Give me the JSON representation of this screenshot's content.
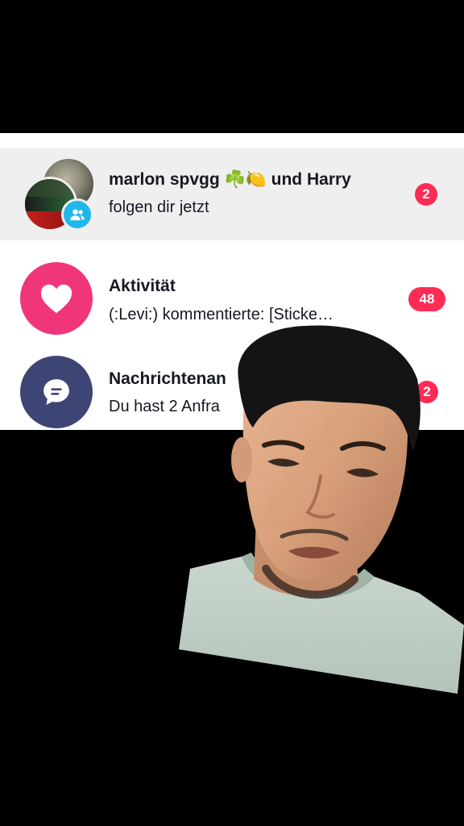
{
  "notifications": [
    {
      "title": "marlon spvgg ☘️🍋 und Harry",
      "subtitle": "folgen dir jetzt",
      "badge": "2",
      "icon": "group-followers-icon"
    },
    {
      "title": "Aktivität",
      "subtitle": "(:Levi:) kommentierte: [Sticke…",
      "badge": "48",
      "icon": "heart-icon"
    },
    {
      "title": "Nachrichtenan",
      "subtitle": "Du hast 2 Anfra",
      "badge": "2",
      "icon": "message-bubble-icon"
    }
  ],
  "colors": {
    "badge_red": "#fe2c55",
    "activity_pink": "#f0357a",
    "requests_navy": "#3d4575",
    "followers_blue": "#20b6ea",
    "highlight_bg": "#efefef",
    "text_dark": "#161823"
  }
}
